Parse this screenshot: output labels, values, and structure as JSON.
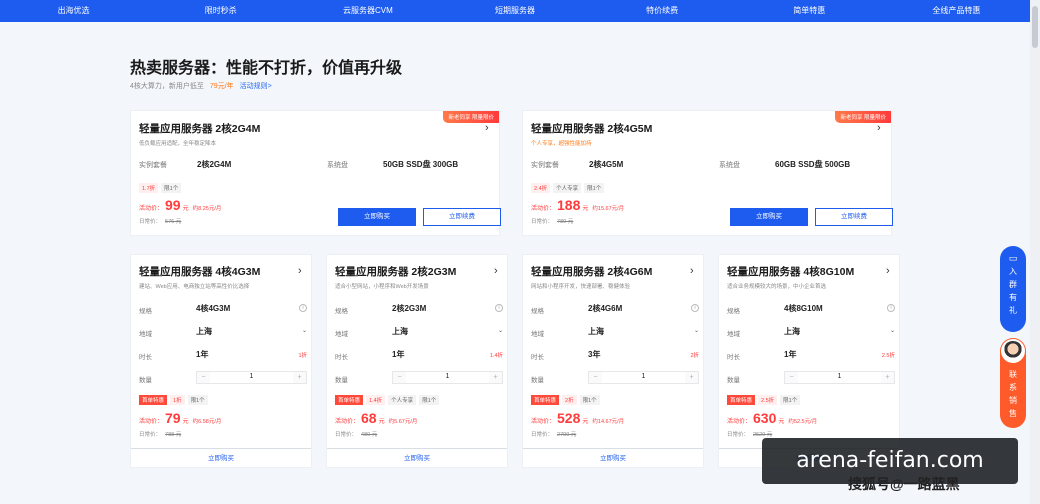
{
  "nav": [
    "出海优选",
    "限时秒杀",
    "云服务器CVM",
    "短期服务器",
    "特价续费",
    "简单特惠",
    "全线产品特惠"
  ],
  "header": {
    "title": "热卖服务器：性能不打折，价值再升级",
    "subtitle_text": "4核大算力，新用户低至",
    "subtitle_price": "79元/年",
    "subtitle_link": "活动规则>"
  },
  "wide_cards": [
    {
      "badge": "新老同享 限量限价",
      "title": "轻量应用服务器 2核2G4M",
      "desc": "低负载应用适配，全年稳定降本",
      "spec1_label": "实例套餐",
      "spec1_value": "2核2G4M",
      "spec2_label": "系统盘",
      "spec2_value": "50GB SSD盘 300GB",
      "tag1": "1.7折",
      "tag2": "",
      "tag3": "限1个",
      "price_label": "活动价：",
      "price": "99",
      "price_unit": "元",
      "price_month": "约8.25元/月",
      "daily_label": "日常价：",
      "daily_price": "576 元",
      "buy": "立即购买",
      "renew": "立即续费"
    },
    {
      "badge": "新老同享 限量限价",
      "title": "轻量应用服务器 2核4G5M",
      "desc": "个人专享，超强性能加持",
      "spec1_label": "实例套餐",
      "spec1_value": "2核4G5M",
      "spec2_label": "系统盘",
      "spec2_value": "60GB SSD盘 500GB",
      "tag1": "2.4折",
      "tag2": "个人专享",
      "tag3": "限1个",
      "price_label": "活动价：",
      "price": "188",
      "price_unit": "元",
      "price_month": "约15.67元/月",
      "daily_label": "日常价：",
      "daily_price": "780 元",
      "buy": "立即购买",
      "renew": "立即续费"
    }
  ],
  "small_cards": [
    {
      "title": "轻量应用服务器 4核4G3M",
      "desc": "建站、Web应用、电商独立站等高性价比选择",
      "spec_label": "规格",
      "spec_value": "4核4G3M",
      "region_label": "地域",
      "region_value": "上海",
      "duration_label": "时长",
      "duration_value": "1年",
      "duration_discount": "1折",
      "qty_label": "数量",
      "qty_value": "1",
      "tag0": "首单特惠",
      "tag1": "1折",
      "tag2": "",
      "tag3": "限1个",
      "price_label": "活动价：",
      "price": "79",
      "price_unit": "元",
      "price_month": "约6.58元/月",
      "daily_label": "日常价：",
      "daily_price": "788 元",
      "buy": "立即购买"
    },
    {
      "title": "轻量应用服务器 2核2G3M",
      "desc": "适合小型网站，小程序和Web开发场景",
      "spec_label": "规格",
      "spec_value": "2核2G3M",
      "region_label": "地域",
      "region_value": "上海",
      "duration_label": "时长",
      "duration_value": "1年",
      "duration_discount": "1.4折",
      "qty_label": "数量",
      "qty_value": "1",
      "tag0": "首单特惠",
      "tag1": "1.4折",
      "tag2": "个人专享",
      "tag3": "限1个",
      "price_label": "活动价：",
      "price": "68",
      "price_unit": "元",
      "price_month": "约5.67元/月",
      "daily_label": "日常价：",
      "daily_price": "480 元",
      "buy": "立即购买"
    },
    {
      "title": "轻量应用服务器 2核4G6M",
      "desc": "网站和小程序开发，快速部署、稳健体验",
      "spec_label": "规格",
      "spec_value": "2核4G6M",
      "region_label": "地域",
      "region_value": "上海",
      "duration_label": "时长",
      "duration_value": "3年",
      "duration_discount": "2折",
      "qty_label": "数量",
      "qty_value": "1",
      "tag0": "首单特惠",
      "tag1": "2折",
      "tag2": "",
      "tag3": "限1个",
      "price_label": "活动价：",
      "price": "528",
      "price_unit": "元",
      "price_month": "约14.67元/月",
      "daily_label": "日常价：",
      "daily_price": "2700 元",
      "buy": "立即购买"
    },
    {
      "title": "轻量应用服务器 4核8G10M",
      "desc": "适合业务规模较大的场景，中小企业首选",
      "spec_label": "规格",
      "spec_value": "4核8G10M",
      "region_label": "地域",
      "region_value": "上海",
      "duration_label": "时长",
      "duration_value": "1年",
      "duration_discount": "2.5折",
      "qty_label": "数量",
      "qty_value": "1",
      "tag0": "首单特惠",
      "tag1": "2.5折",
      "tag2": "",
      "tag3": "限1个",
      "price_label": "活动价：",
      "price": "630",
      "price_unit": "元",
      "price_month": "约52.5元/月",
      "daily_label": "日常价：",
      "daily_price": "2520 元",
      "buy": "立即购买"
    }
  ],
  "float": {
    "group_text": "入群有礼",
    "contact_text": "联系销售"
  },
  "watermark": "arena-feifan.com",
  "watermark_sub": "搜狐号@一路蓝黑"
}
